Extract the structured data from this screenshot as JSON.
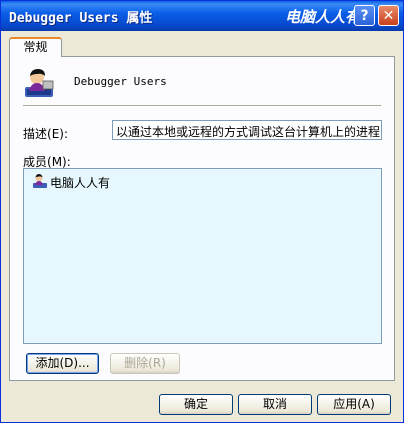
{
  "window": {
    "title": "Debugger Users 属性",
    "watermark": "电脑人人有"
  },
  "title_buttons": {
    "help": "?",
    "close": "✕"
  },
  "tabs": [
    {
      "label": "常规"
    }
  ],
  "group": {
    "name": "Debugger Users",
    "icon": "group-users-icon"
  },
  "description": {
    "label_text": "描述",
    "label_key": "(E):",
    "value": "以通过本地或远程的方式调试这台计算机上的进程"
  },
  "members": {
    "label_text": "成员",
    "label_key": "(M):",
    "items": [
      {
        "name": "电脑人人有",
        "icon": "user-icon"
      }
    ]
  },
  "buttons": {
    "add": "添加(D)...",
    "remove": "删除(R)",
    "ok": "确定",
    "cancel": "取消",
    "apply": "应用(A)"
  },
  "colors": {
    "titlebar": "#0a5ee8",
    "face": "#ece9d8",
    "list_bg": "#e6f8fd",
    "tab_accent": "#e68b2c"
  }
}
